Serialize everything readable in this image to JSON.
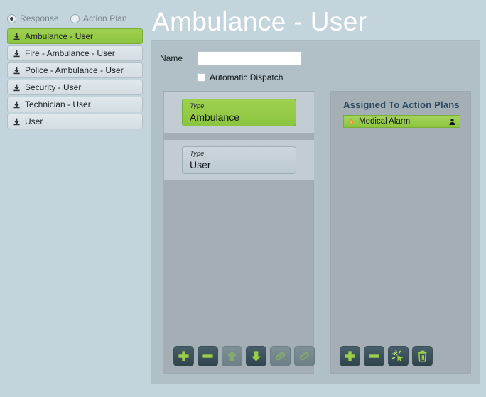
{
  "sidebar": {
    "modes": [
      {
        "label": "Response",
        "selected": true
      },
      {
        "label": "Action Plan",
        "selected": false
      }
    ],
    "items": [
      {
        "label": "Ambulance - User",
        "icon": "download-icon",
        "active": true
      },
      {
        "label": "Fire - Ambulance - User",
        "icon": "download-icon",
        "active": false
      },
      {
        "label": "Police - Ambulance - User",
        "icon": "download-icon",
        "active": false
      },
      {
        "label": "Security - User",
        "icon": "download-icon",
        "active": false
      },
      {
        "label": "Technician - User",
        "icon": "download-icon",
        "active": false
      },
      {
        "label": "User",
        "icon": "download-icon",
        "active": false
      }
    ]
  },
  "header": {
    "title": "Ambulance - User"
  },
  "form": {
    "name_label": "Name",
    "name_value": "",
    "name_placeholder": "",
    "dispatch_label": "Automatic Dispatch",
    "dispatch_checked": false
  },
  "types_panel": {
    "cards": [
      {
        "kicker": "Type",
        "value": "Ambulance",
        "selected": true
      },
      {
        "kicker": "Type",
        "value": "User",
        "selected": false
      }
    ],
    "toolbar": [
      {
        "name": "add-button",
        "icon": "plus-icon",
        "enabled": true
      },
      {
        "name": "remove-button",
        "icon": "minus-icon",
        "enabled": true
      },
      {
        "name": "move-up-button",
        "icon": "arrow-up-icon",
        "enabled": false
      },
      {
        "name": "move-down-button",
        "icon": "arrow-down-icon",
        "enabled": true
      },
      {
        "name": "link-button",
        "icon": "link-icon",
        "enabled": false
      },
      {
        "name": "unlink-button",
        "icon": "broken-link-icon",
        "enabled": false
      }
    ]
  },
  "assigned_panel": {
    "title": "Assigned To Action Plans",
    "items": [
      {
        "label": "Medical Alarm",
        "left_icon": "alarm-icon",
        "right_icon": "user-icon",
        "selected": true
      }
    ],
    "toolbar": [
      {
        "name": "add-plan-button",
        "icon": "plus-icon",
        "enabled": true
      },
      {
        "name": "remove-plan-button",
        "icon": "minus-icon",
        "enabled": true
      },
      {
        "name": "trigger-button",
        "icon": "burst-click-icon",
        "enabled": true
      },
      {
        "name": "delete-button",
        "icon": "trash-icon",
        "enabled": true
      }
    ]
  },
  "colors": {
    "page_background": "#c4d4dc",
    "accent_green": "#8bc53f",
    "panel": "#b1c0c7",
    "inner_panel": "#a3afb4",
    "title_text": "#ffffff",
    "assigned_title": "#2e4a63",
    "button_dark": "#33474f"
  }
}
